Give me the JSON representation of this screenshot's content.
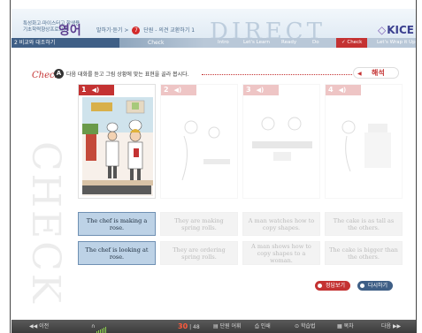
{
  "header": {
    "brand_small_line1": "특성화고·마이스터고 학생용",
    "brand_small_line2": "기초학력향상프로그램",
    "brand_big": "영어",
    "crumb_before": "말하기·듣기 >",
    "crumb_num": "7",
    "crumb_after": "단원 - 의견 교환하기 1",
    "deco_letters": "DIRECT",
    "kice": "KICE",
    "kice_mark": "◇"
  },
  "nav": {
    "lesson": "2   비교와 대조하기",
    "section": "Check",
    "steps": [
      "Intro",
      "Let's Learn",
      "Ready",
      "Do",
      "✓ Check",
      "Let's Wrap it Up"
    ],
    "active_index": 4
  },
  "check": {
    "label": "Check",
    "badge": "A",
    "instruction": "다음 대화를 듣고 그림 상황에 맞는 표현을 골라 봅시다.",
    "answer_button": "해석",
    "side_text": "CHECK"
  },
  "panels": [
    {
      "number": "1",
      "faded": false,
      "options": [
        "The chef is making a rose.",
        "The chef is looking at rose."
      ]
    },
    {
      "number": "2",
      "faded": true,
      "options": [
        "They are making spring rolls.",
        "They are ordering spring rolls."
      ]
    },
    {
      "number": "3",
      "faded": true,
      "options": [
        "A man watches how to copy shapes.",
        "A man shows how to copy shapes to a woman."
      ]
    },
    {
      "number": "4",
      "faded": true,
      "options": [
        "The cake is as tall as the others.",
        "The cake is bigger than the others."
      ]
    }
  ],
  "actions": {
    "show_answer": "정답보기",
    "retry": "다시하기"
  },
  "bottombar": {
    "prev": "◀◀ 이전",
    "audio_icon": "headphones-icon",
    "page_current": "30",
    "page_total": "48",
    "vocab": "단원 어휘",
    "print": "인쇄",
    "study_method": "학습법",
    "toc": "목차",
    "next": "다음 ▶▶"
  },
  "colors": {
    "accent": "#c43232",
    "nav_dark": "#3f5f86",
    "option_bg": "#bdd2e6"
  }
}
